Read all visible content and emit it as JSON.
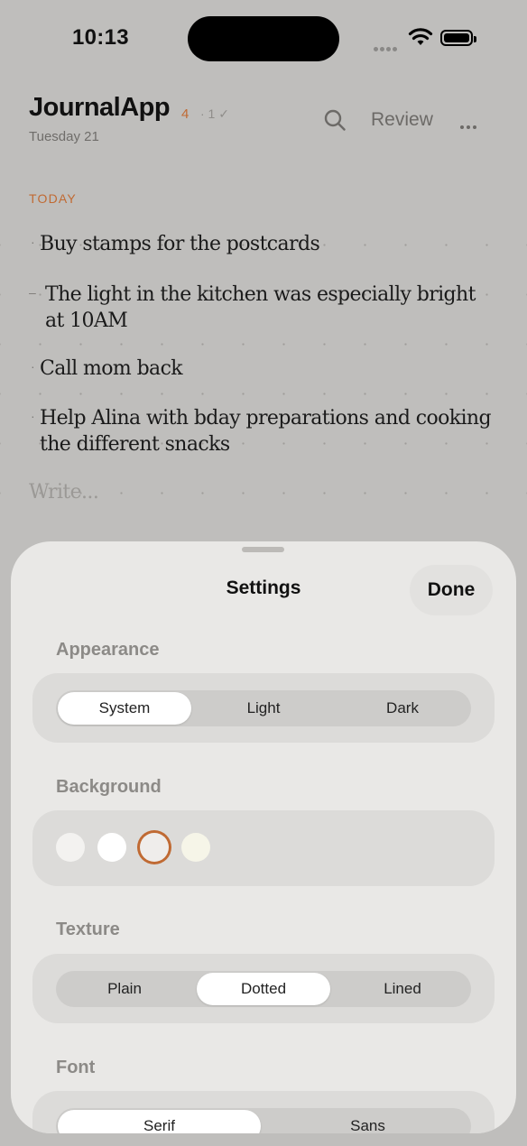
{
  "status_bar": {
    "time": "10:13"
  },
  "header": {
    "app_title": "JournalApp",
    "open_count": "4",
    "done_count": "· 1 ✓",
    "date": "Tuesday 21",
    "review_label": "Review"
  },
  "section": {
    "label": "TODAY"
  },
  "notes": [
    {
      "text": "Buy stamps for the postcards",
      "bullet": "·"
    },
    {
      "text": "The light in the kitchen was especially bright at 10AM",
      "bullet": "–"
    },
    {
      "text": "Call mom back",
      "bullet": "·"
    },
    {
      "text": "Help Alina with bday preparations and cooking the different snacks",
      "bullet": "·"
    }
  ],
  "composer": {
    "placeholder": "Write..."
  },
  "settings": {
    "title": "Settings",
    "done_label": "Done",
    "appearance": {
      "label": "Appearance",
      "options": [
        "System",
        "Light",
        "Dark"
      ],
      "selected": "System"
    },
    "background": {
      "label": "Background",
      "swatches": [
        "#f3f2f0",
        "#ffffff",
        "#efedeb",
        "#f6f5e8"
      ],
      "selected_index": 2
    },
    "texture": {
      "label": "Texture",
      "options": [
        "Plain",
        "Dotted",
        "Lined"
      ],
      "selected": "Dotted"
    },
    "font": {
      "label": "Font",
      "options": [
        "Serif",
        "Sans"
      ],
      "selected": "Serif"
    }
  },
  "colors": {
    "accent": "#c06a33",
    "dimmed_background": "#bfbebc",
    "sheet": "#e9e8e6"
  }
}
